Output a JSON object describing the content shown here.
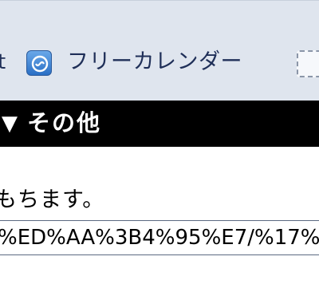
{
  "toolbar": {
    "cut_label": "t",
    "app_label": "フリーカレンダー",
    "app_icon": "calendar-app-icon"
  },
  "section": {
    "arrow": "▼",
    "title": "その他"
  },
  "content": {
    "info_text": "もちます。",
    "url_value": "%ED%AA%3B4%95%E7/%17%"
  },
  "colors": {
    "toolbar_bg": "#dfe5ee",
    "section_bg": "#000000",
    "label_text": "#1f2f58"
  }
}
